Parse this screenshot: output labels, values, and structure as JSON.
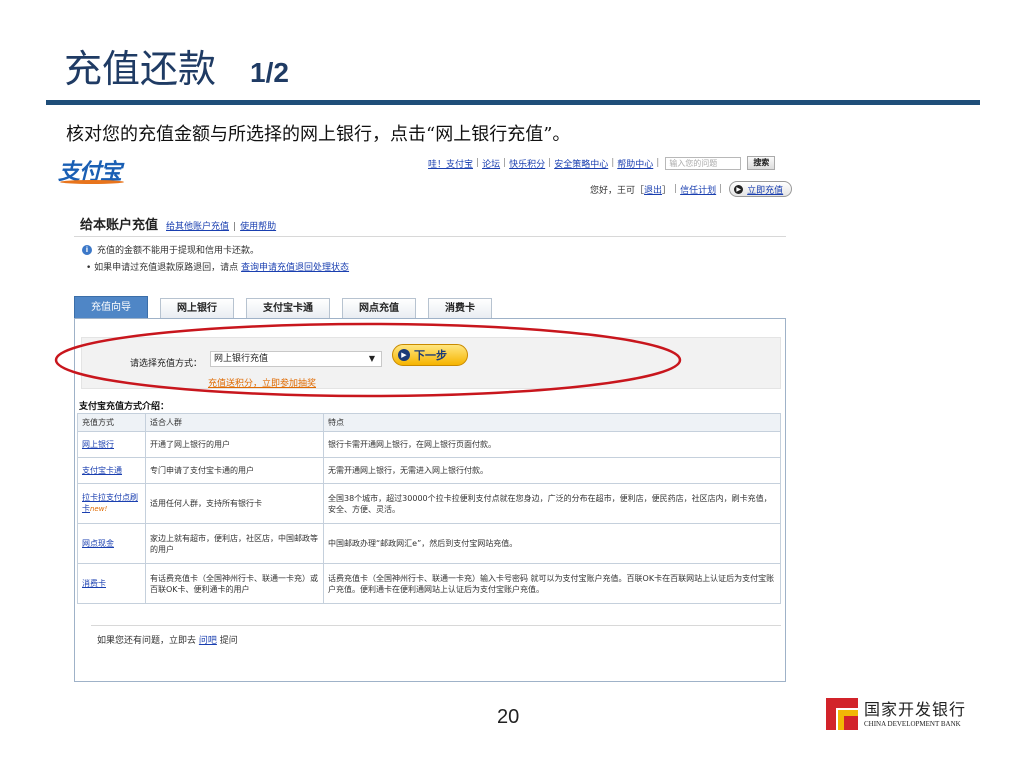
{
  "slide": {
    "title": "充值还款",
    "page_indicator": "1/2",
    "instruction": "核对您的充值金额与所选择的网上银行，点击“网上银行充值”。",
    "slide_number": "20"
  },
  "footer_logo": {
    "name_cn": "国家开发银行",
    "name_en": "CHINA DEVELOPMENT BANK"
  },
  "web": {
    "logo_text": "支付宝",
    "top_links": [
      "哇！支付宝",
      "论坛",
      "快乐积分",
      "安全策略中心",
      "帮助中心"
    ],
    "search": {
      "placeholder": "输入您的问题",
      "button": "搜索"
    },
    "user": {
      "greeting": "您好，王可",
      "logout": "退出",
      "credit_plan": "信任计划",
      "pay_now": "立即充值"
    },
    "page_heading": "给本账户充值",
    "heading_links": [
      "给其他账户充值",
      "使用帮助"
    ],
    "notice": {
      "line1": "充值的金额不能用于提现和信用卡还款。",
      "line2_prefix": "• 如果申请过充值退款原路退回，请点",
      "line2_link": "查询申请充值退回处理状态"
    },
    "tabs": [
      {
        "label": "充值向导",
        "active": true
      },
      {
        "label": "网上银行"
      },
      {
        "label": "支付宝卡通"
      },
      {
        "label": "网点充值"
      },
      {
        "label": "消费卡"
      }
    ],
    "selector": {
      "label": "请选择充值方式：",
      "value": "网上银行充值",
      "next_button": "下一步",
      "promo": "充值送积分，立即参加抽奖"
    },
    "methods_title": "支付宝充值方式介绍：",
    "table": {
      "headers": [
        "充值方式",
        "适合人群",
        "特点"
      ],
      "rows": [
        {
          "method": "网上银行",
          "badge": "",
          "audience": "开通了网上银行的用户",
          "features": "银行卡需开通网上银行，在网上银行页面付款。"
        },
        {
          "method": "支付宝卡通",
          "badge": "",
          "audience": "专门申请了支付宝卡通的用户",
          "features": "无需开通网上银行，无需进入网上银行付款。"
        },
        {
          "method": "拉卡拉支付点刷卡",
          "badge": "new!",
          "audience": "适用任何人群，支持所有银行卡",
          "features": "全国38个城市，超过30000个拉卡拉便利支付点就在您身边，广泛的分布在超市，便利店，便民药店，社区店内，刷卡充值，安全、方便、灵活。"
        },
        {
          "method": "网点现金",
          "badge": "",
          "audience": "家边上就有超市，便利店，社区店，中国邮政等的用户",
          "features": "中国邮政办理“邮政网汇e”，然后到支付宝网站充值。"
        },
        {
          "method": "消费卡",
          "badge": "",
          "audience": "有话费充值卡（全国神州行卡、联通一卡充）或百联OK卡、便利通卡的用户",
          "features": "话费充值卡（全国神州行卡、联通一卡充）输入卡号密码 就可以为支付宝账户充值。百联OK卡在百联网站上认证后为支付宝账户充值。便利通卡在便利通网站上认证后为支付宝账户充值。"
        }
      ]
    },
    "footer_help": {
      "prefix": "如果您还有问题，立即去",
      "link": "问吧",
      "suffix": "提问"
    }
  },
  "colors": {
    "title_blue": "#1f3b64",
    "rule_blue": "#1f4e79",
    "highlight_red": "#c8161d",
    "link_blue": "#1a3fb0",
    "promo_orange": "#e06a00"
  }
}
